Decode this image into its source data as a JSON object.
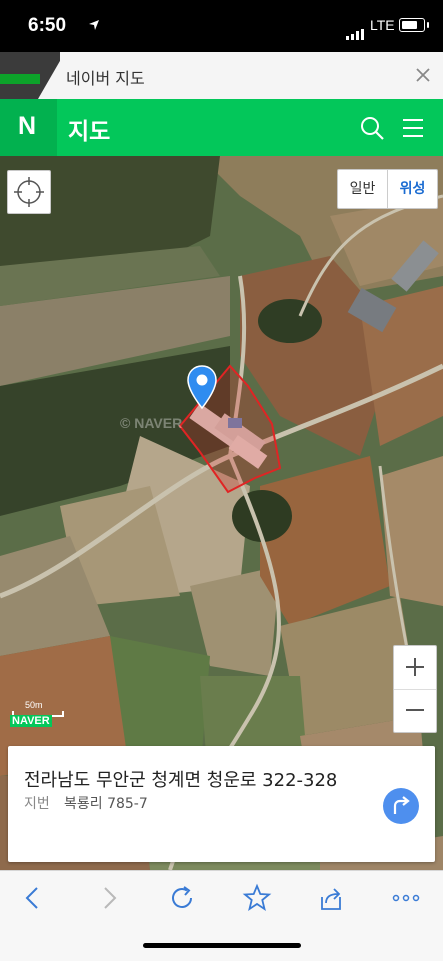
{
  "status_bar": {
    "time": "6:50",
    "network": "LTE"
  },
  "browser_tab": {
    "title": "네이버 지도"
  },
  "header": {
    "logo": "N",
    "title": "지도"
  },
  "map_type": {
    "general": "일반",
    "satellite": "위성",
    "selected": "위성"
  },
  "scale": {
    "label": "50m",
    "brand": "NAVER"
  },
  "address_card": {
    "address": "전라남도 무안군 청계면 청운로 322-328",
    "jibun_label": "지번",
    "jibun": "복룡리 785-7"
  },
  "colors": {
    "naver_green": "#03c75a",
    "selection_red": "#e02424",
    "pin_blue": "#2f8cf0",
    "route_blue": "#4e8fee"
  },
  "icons": [
    "location-arrow-icon",
    "signal-icon",
    "battery-icon",
    "close-icon",
    "search-icon",
    "menu-icon",
    "crosshair-icon",
    "zoom-in-icon",
    "zoom-out-icon",
    "map-pin-icon",
    "route-icon",
    "back-icon",
    "forward-icon",
    "reload-icon",
    "bookmark-star-icon",
    "share-icon",
    "more-icon"
  ]
}
